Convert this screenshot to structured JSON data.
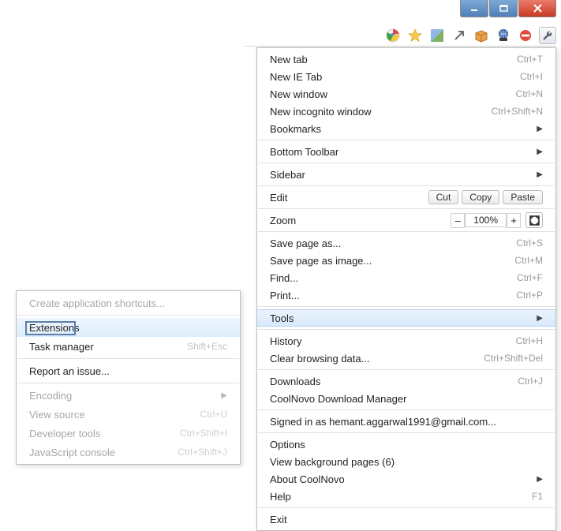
{
  "window_controls": {
    "minimize": "–",
    "maximize": "❐",
    "close": "✕"
  },
  "toolbar_icons": {
    "chrome": "chrome-icon",
    "star": "star-icon",
    "flag": "flag-icon",
    "diag": "diag-arrow-icon",
    "box": "box-icon",
    "globe": "globe-icon",
    "block": "block-icon",
    "wrench": "wrench-icon"
  },
  "menu": {
    "new_tab": {
      "label": "New tab",
      "short": "Ctrl+T"
    },
    "new_ie_tab": {
      "label": "New IE Tab",
      "short": "Ctrl+I"
    },
    "new_window": {
      "label": "New window",
      "short": "Ctrl+N"
    },
    "new_incognito": {
      "label": "New incognito window",
      "short": "Ctrl+Shift+N"
    },
    "bookmarks": {
      "label": "Bookmarks"
    },
    "bottom_toolbar": {
      "label": "Bottom Toolbar"
    },
    "sidebar": {
      "label": "Sidebar"
    },
    "edit": {
      "label": "Edit",
      "cut": "Cut",
      "copy": "Copy",
      "paste": "Paste"
    },
    "zoom": {
      "label": "Zoom",
      "minus": "–",
      "value": "100%",
      "plus": "+"
    },
    "save_page": {
      "label": "Save page as...",
      "short": "Ctrl+S"
    },
    "save_image": {
      "label": "Save page as image...",
      "short": "Ctrl+M"
    },
    "find": {
      "label": "Find...",
      "short": "Ctrl+F"
    },
    "print": {
      "label": "Print...",
      "short": "Ctrl+P"
    },
    "tools": {
      "label": "Tools"
    },
    "history": {
      "label": "History",
      "short": "Ctrl+H"
    },
    "clear_data": {
      "label": "Clear browsing data...",
      "short": "Ctrl+Shift+Del"
    },
    "downloads": {
      "label": "Downloads",
      "short": "Ctrl+J"
    },
    "dl_manager": {
      "label": "CoolNovo Download Manager"
    },
    "signed_in": {
      "label": "Signed in as hemant.aggarwal1991@gmail.com..."
    },
    "options": {
      "label": "Options"
    },
    "bg_pages": {
      "label": "View background pages (6)"
    },
    "about": {
      "label": "About CoolNovo"
    },
    "help": {
      "label": "Help",
      "short": "F1"
    },
    "exit": {
      "label": "Exit"
    }
  },
  "submenu": {
    "create_shortcut": {
      "label": "Create application shortcuts..."
    },
    "extensions": {
      "label": "Extensions"
    },
    "task_manager": {
      "label": "Task manager",
      "short": "Shift+Esc"
    },
    "report_issue": {
      "label": "Report an issue..."
    },
    "encoding": {
      "label": "Encoding"
    },
    "view_source": {
      "label": "View source",
      "short": "Ctrl+U"
    },
    "dev_tools": {
      "label": "Developer tools",
      "short": "Ctrl+Shift+I"
    },
    "js_console": {
      "label": "JavaScript console",
      "short": "Ctrl+Shift+J"
    }
  }
}
